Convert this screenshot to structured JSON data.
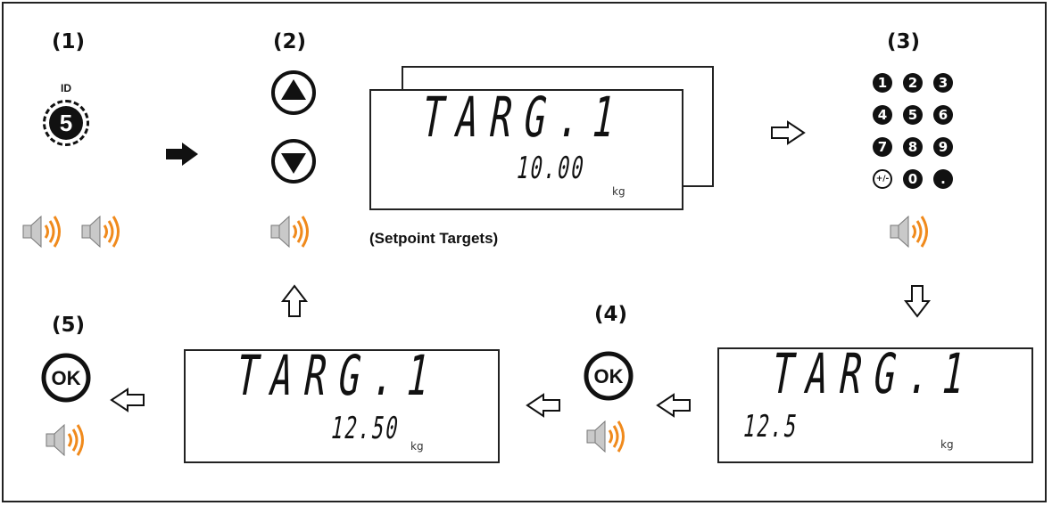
{
  "steps": {
    "s1": "(1)",
    "s2": "(2)",
    "s3": "(3)",
    "s4": "(4)",
    "s5": "(5)"
  },
  "id_key": {
    "label": "ID",
    "number": "5"
  },
  "displays": {
    "top": {
      "title": "TARG.1",
      "value": "10.00",
      "unit": "kg"
    },
    "bottom_left": {
      "title": "TARG.1",
      "value": "12.50",
      "unit": "kg"
    },
    "bottom_right": {
      "title": "TARG.1",
      "value": "12.5",
      "unit": "kg"
    }
  },
  "caption": "(Setpoint Targets)",
  "keypad": [
    "1",
    "2",
    "3",
    "4",
    "5",
    "6",
    "7",
    "8",
    "9",
    "+/-",
    "0",
    "."
  ],
  "ok_label": "OK",
  "colors": {
    "speaker_wave": "#f08a1c",
    "speaker_body": "#c9c9c9",
    "ink": "#111111"
  }
}
